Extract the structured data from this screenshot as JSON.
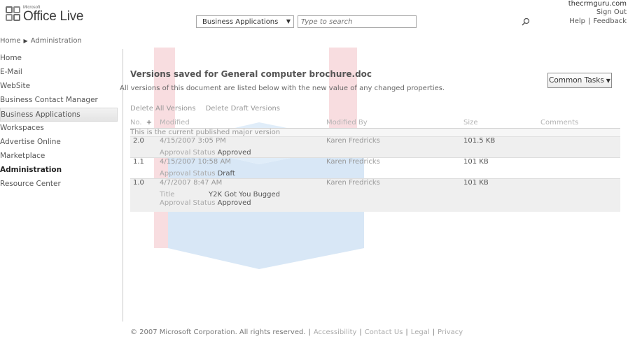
{
  "header": {
    "logo_microsoft": "Microsoft",
    "logo_name": "Office Live",
    "breadcrumb": [
      "Home",
      "Administration"
    ],
    "search_scope": "Business Applications",
    "search_placeholder": "Type to search",
    "user": "thecrmguru.com",
    "sign_out": "Sign Out",
    "help": "Help",
    "feedback": "Feedback"
  },
  "nav": {
    "items": [
      {
        "label": "Home"
      },
      {
        "label": "E-Mail"
      },
      {
        "label": "WebSite"
      },
      {
        "label": "Business Contact Manager"
      },
      {
        "label": "Business Applications"
      },
      {
        "label": "Workspaces"
      },
      {
        "label": "Advertise Online"
      },
      {
        "label": "Marketplace"
      },
      {
        "label": "Administration"
      },
      {
        "label": "Resource Center"
      }
    ]
  },
  "main": {
    "title": "Versions saved for General computer brochure.doc",
    "description": "All versions of this document are listed below with the new value of any changed properties.",
    "common_tasks": "Common Tasks",
    "actions": [
      "Delete All Versions",
      "Delete Draft Versions"
    ],
    "columns": {
      "no": "No.",
      "modified": "Modified",
      "modified_by": "Modified By",
      "size": "Size",
      "comments": "Comments"
    },
    "current_note": "This is the current published major version",
    "versions": [
      {
        "no": "2.0",
        "modified": "4/15/2007 3:05 PM",
        "by": "Karen Fredricks",
        "size": "101.5 KB",
        "props": [
          {
            "name": "Approval Status",
            "value": "Approved"
          }
        ]
      },
      {
        "no": "1.1",
        "modified": "4/15/2007 10:58 AM",
        "by": "Karen Fredricks",
        "size": "101 KB",
        "props": [
          {
            "name": "Approval Status",
            "value": "Draft"
          }
        ]
      },
      {
        "no": "1.0",
        "modified": "4/7/2007 8:47 AM",
        "by": "Karen Fredricks",
        "size": "101 KB",
        "props": [
          {
            "name": "Title",
            "value": "Y2K Got You Bugged"
          },
          {
            "name": "Approval Status",
            "value": "Approved"
          }
        ]
      }
    ]
  },
  "footer": {
    "copyright": "© 2007 Microsoft Corporation. All rights reserved.",
    "links": [
      "Accessibility",
      "Contact Us",
      "Legal",
      "Privacy"
    ]
  },
  "colors": {
    "watermark_red": "#d94a5a",
    "watermark_blue": "#2d7fd0"
  }
}
